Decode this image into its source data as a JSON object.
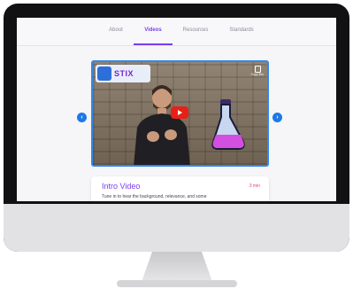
{
  "tabs": [
    {
      "label": "About",
      "active": false
    },
    {
      "label": "Videos",
      "active": true
    },
    {
      "label": "Resources",
      "active": false
    },
    {
      "label": "Standards",
      "active": false
    }
  ],
  "carousel": {
    "prev_icon": "chevron-left-icon",
    "next_icon": "chevron-right-icon",
    "prev_symbol": "‹",
    "next_symbol": "›"
  },
  "video": {
    "brand_text": "STIX",
    "copy_label": "Copy link",
    "play_icon": "play-icon"
  },
  "card": {
    "title": "Intro Video",
    "duration": "3 min",
    "description": "Tune in to hear the background, relevance, and some"
  },
  "colors": {
    "accent": "#7a3ff0",
    "arrow": "#1c79e8",
    "video_border": "#2f88f0",
    "duration": "#e0457b",
    "play": "#e62117"
  }
}
